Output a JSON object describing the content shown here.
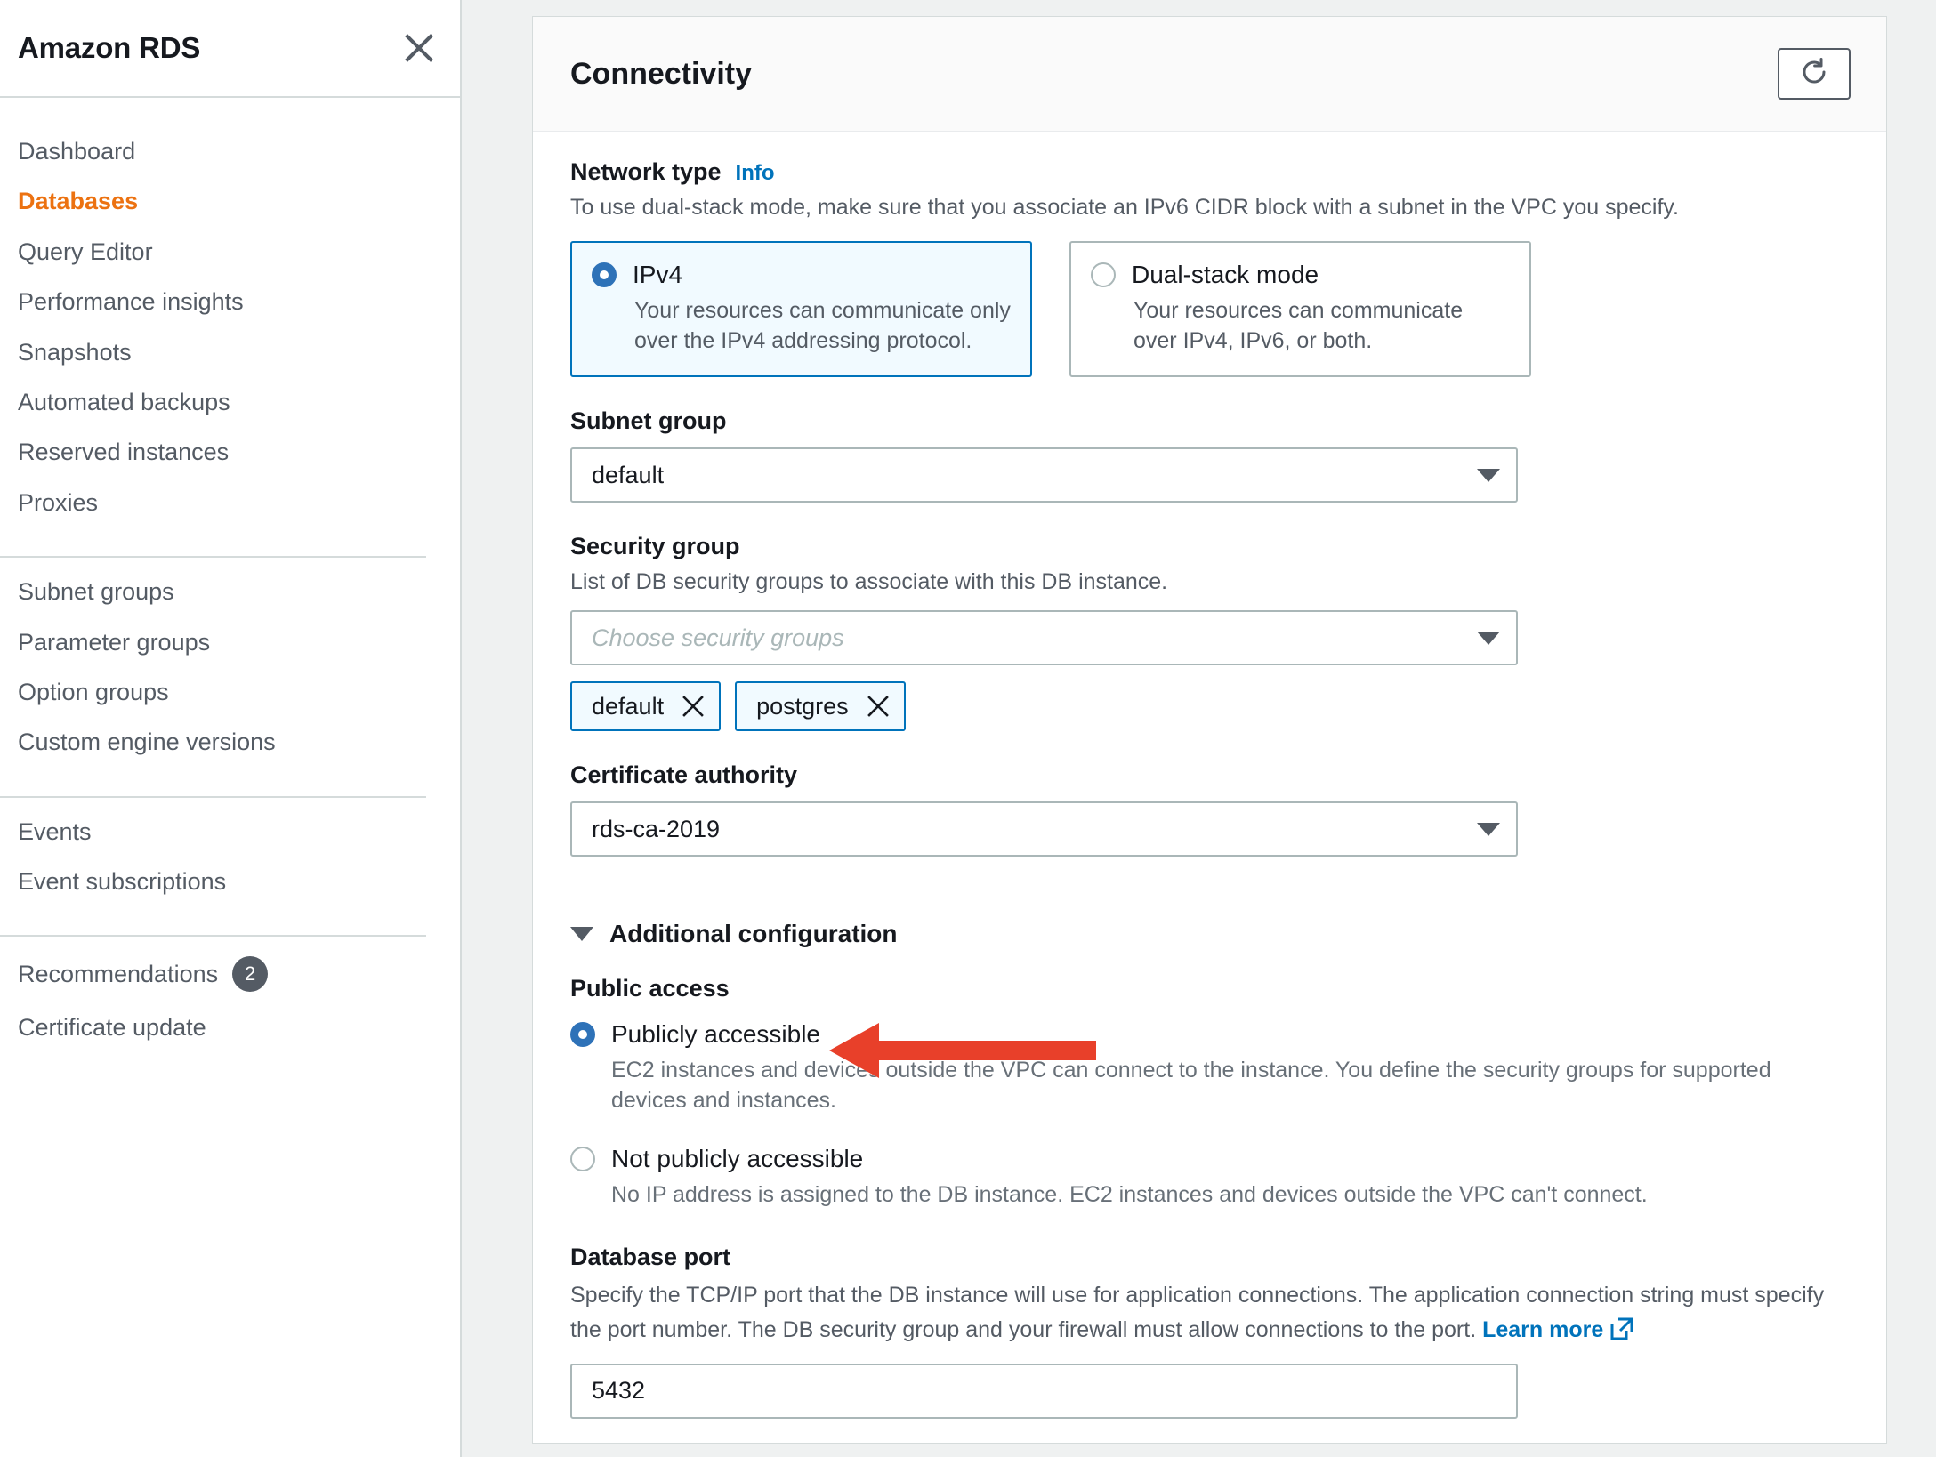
{
  "sidebar": {
    "title": "Amazon RDS",
    "close_icon": "close-icon",
    "groups": [
      {
        "items": [
          {
            "label": "Dashboard",
            "active": false
          },
          {
            "label": "Databases",
            "active": true
          },
          {
            "label": "Query Editor",
            "active": false
          },
          {
            "label": "Performance insights",
            "active": false
          },
          {
            "label": "Snapshots",
            "active": false
          },
          {
            "label": "Automated backups",
            "active": false
          },
          {
            "label": "Reserved instances",
            "active": false
          },
          {
            "label": "Proxies",
            "active": false
          }
        ]
      },
      {
        "items": [
          {
            "label": "Subnet groups",
            "active": false
          },
          {
            "label": "Parameter groups",
            "active": false
          },
          {
            "label": "Option groups",
            "active": false
          },
          {
            "label": "Custom engine versions",
            "active": false
          }
        ]
      },
      {
        "items": [
          {
            "label": "Events",
            "active": false
          },
          {
            "label": "Event subscriptions",
            "active": false
          }
        ]
      },
      {
        "items": [
          {
            "label": "Recommendations",
            "active": false,
            "badge": "2"
          },
          {
            "label": "Certificate update",
            "active": false
          }
        ]
      }
    ]
  },
  "panel": {
    "title": "Connectivity",
    "refresh_icon": "refresh-icon"
  },
  "network_type": {
    "label": "Network type",
    "info_label": "Info",
    "description": "To use dual-stack mode, make sure that you associate an IPv6 CIDR block with a subnet in the VPC you specify.",
    "options": [
      {
        "title": "IPv4",
        "description": "Your resources can communicate only over the IPv4 addressing protocol.",
        "selected": true
      },
      {
        "title": "Dual-stack mode",
        "description": "Your resources can communicate over IPv4, IPv6, or both.",
        "selected": false
      }
    ]
  },
  "subnet_group": {
    "label": "Subnet group",
    "value": "default"
  },
  "security_group": {
    "label": "Security group",
    "description": "List of DB security groups to associate with this DB instance.",
    "placeholder": "Choose security groups",
    "tokens": [
      {
        "label": "default"
      },
      {
        "label": "postgres"
      }
    ]
  },
  "certificate_authority": {
    "label": "Certificate authority",
    "value": "rds-ca-2019"
  },
  "additional_configuration": {
    "label": "Additional configuration",
    "expanded": true
  },
  "public_access": {
    "label": "Public access",
    "options": [
      {
        "label": "Publicly accessible",
        "description": "EC2 instances and devices outside the VPC can connect to the instance. You define the security groups for supported devices and instances.",
        "selected": true
      },
      {
        "label": "Not publicly accessible",
        "description": "No IP address is assigned to the DB instance. EC2 instances and devices outside the VPC can't connect.",
        "selected": false
      }
    ]
  },
  "database_port": {
    "label": "Database port",
    "description_part1": "Specify the TCP/IP port that the DB instance will use for application connections. The application connection string must specify the",
    "description_part2": "port number. The DB security group and your firewall must allow connections to the port.",
    "learn_more": "Learn more",
    "value": "5432"
  },
  "annotation": {
    "arrow_color": "#e8402a",
    "points_at": "Publicly accessible"
  },
  "colors": {
    "accent_orange": "#ec7211",
    "link_blue": "#0073bb",
    "radio_blue": "#2e72b8",
    "arrow_red": "#e8402a"
  }
}
